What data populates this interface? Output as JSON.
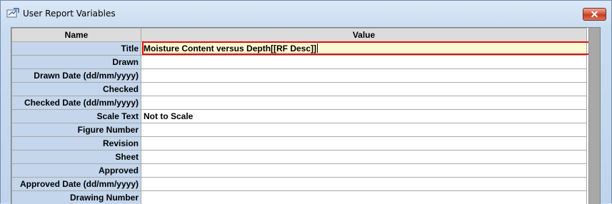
{
  "window": {
    "title": "User Report Variables",
    "icon": "app-icon",
    "close_label": "✕"
  },
  "grid": {
    "headers": {
      "name": "Name",
      "value": "Value"
    },
    "rows": [
      {
        "name": "Title",
        "value": "Moisture Content versus Depth[[RF Desc]]"
      },
      {
        "name": "Drawn",
        "value": ""
      },
      {
        "name": "Drawn Date (dd/mm/yyyy)",
        "value": ""
      },
      {
        "name": "Checked",
        "value": ""
      },
      {
        "name": "Checked Date (dd/mm/yyyy)",
        "value": ""
      },
      {
        "name": "Scale Text",
        "value": "Not to Scale"
      },
      {
        "name": "Figure Number",
        "value": ""
      },
      {
        "name": "Revision",
        "value": ""
      },
      {
        "name": "Sheet",
        "value": ""
      },
      {
        "name": "Approved",
        "value": ""
      },
      {
        "name": "Approved Date (dd/mm/yyyy)",
        "value": ""
      },
      {
        "name": "Drawing Number",
        "value": ""
      }
    ],
    "selected_row": 0
  },
  "colors": {
    "name_cell": "#c3d6ec",
    "header": "#dcdcdc",
    "edit_border": "#e01010",
    "edit_bg": "#fffad2",
    "scrollbar": "#a8a8a8"
  }
}
